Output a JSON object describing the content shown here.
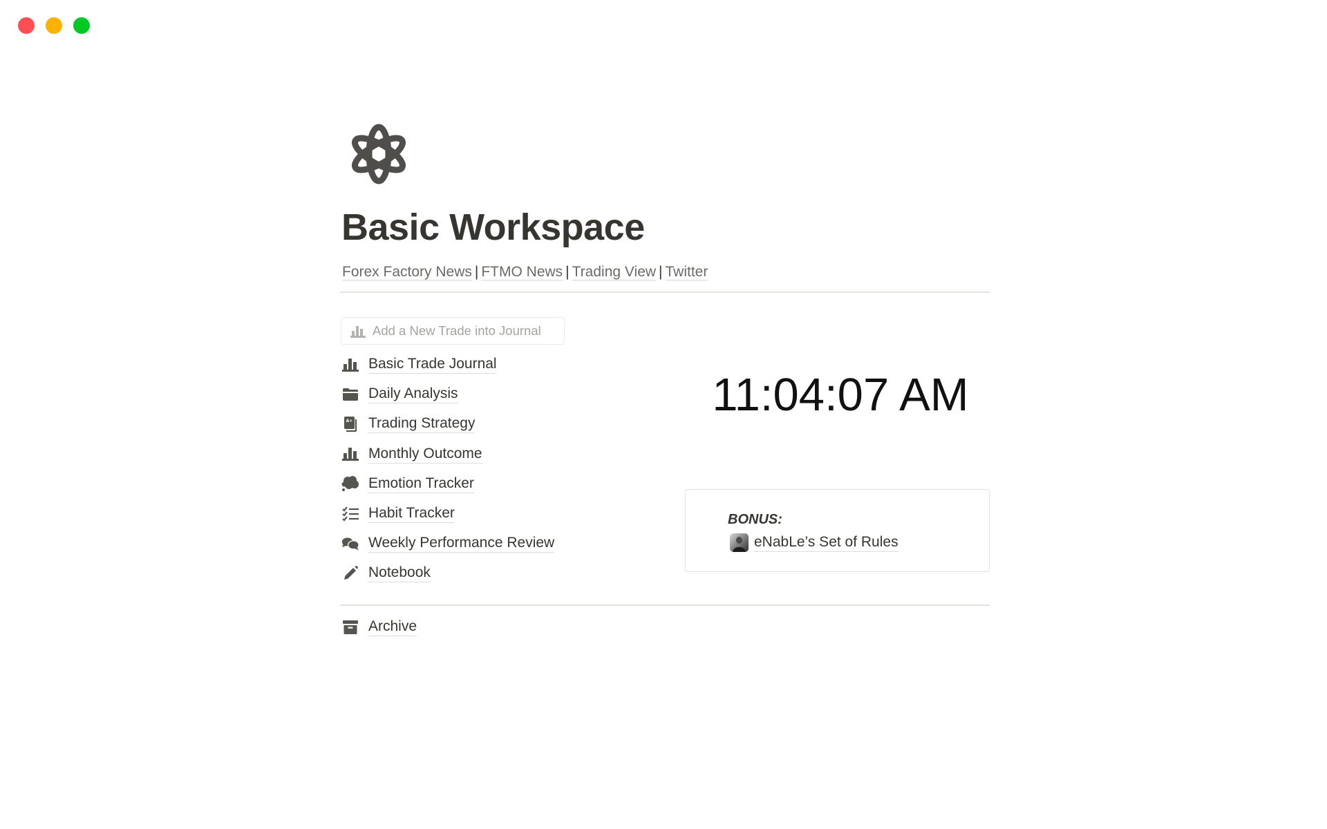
{
  "window": {
    "controls": [
      "close",
      "minimize",
      "maximize"
    ],
    "colors": {
      "close": "#ff4f52",
      "minimize": "#ffb100",
      "maximize": "#00c924"
    }
  },
  "page": {
    "icon": "atom-icon",
    "title": "Basic Workspace",
    "links": [
      {
        "label": "Forex Factory News"
      },
      {
        "label": "FTMO News"
      },
      {
        "label": "Trading View"
      },
      {
        "label": "Twitter"
      }
    ],
    "link_separator": "|"
  },
  "add_button": {
    "label": "Add a New Trade into Journal",
    "icon": "bar-chart-icon"
  },
  "nav": {
    "items": [
      {
        "label": "Basic Trade Journal",
        "icon": "bar-chart-icon"
      },
      {
        "label": "Daily Analysis",
        "icon": "folder-icon"
      },
      {
        "label": "Trading Strategy",
        "icon": "grade-book-icon"
      },
      {
        "label": "Monthly Outcome",
        "icon": "bar-chart-icon"
      },
      {
        "label": "Emotion Tracker",
        "icon": "thought-bubble-icon"
      },
      {
        "label": "Habit Tracker",
        "icon": "checklist-icon"
      },
      {
        "label": "Weekly Performance Review",
        "icon": "chat-bubbles-icon"
      },
      {
        "label": "Notebook",
        "icon": "pencil-icon"
      }
    ],
    "archive": {
      "label": "Archive",
      "icon": "archive-box-icon"
    }
  },
  "clock": {
    "time": "11:04:07 AM"
  },
  "bonus": {
    "heading": "BONUS:",
    "link": {
      "label": "eNabLe’s Set of Rules",
      "icon": "avatar"
    }
  }
}
